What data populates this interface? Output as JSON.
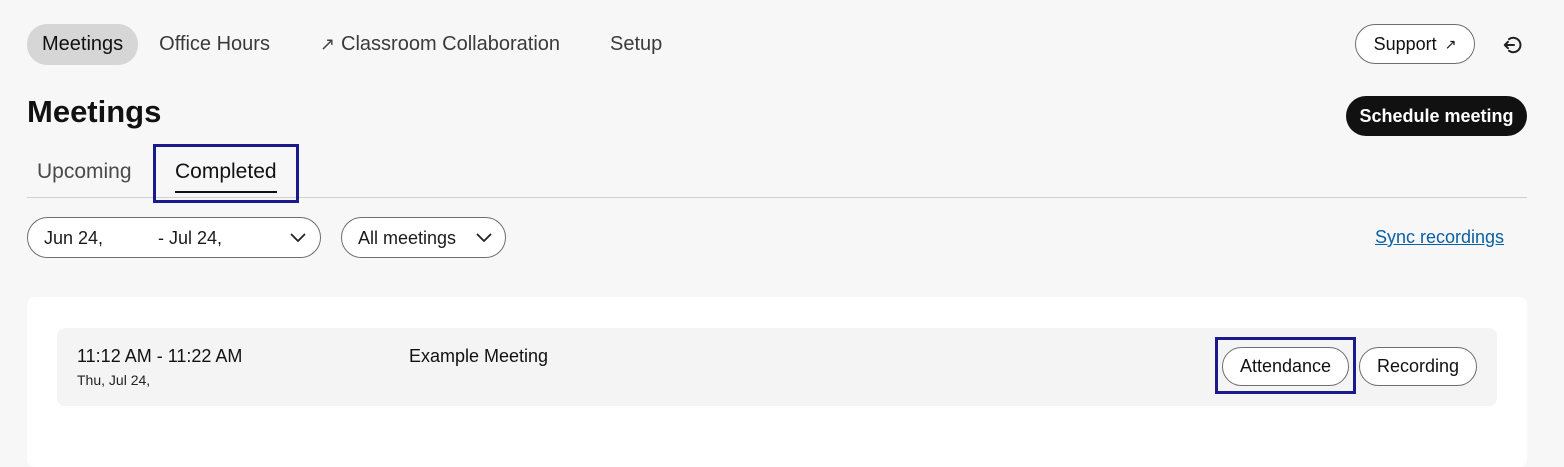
{
  "nav": {
    "items": [
      {
        "label": "Meetings",
        "active": true
      },
      {
        "label": "Office Hours"
      },
      {
        "label": "Classroom Collaboration",
        "external": true
      },
      {
        "label": "Setup"
      }
    ],
    "external_icon": "↗"
  },
  "header": {
    "support_label": "Support",
    "support_icon": "↗",
    "signout_icon": "sign-out-icon"
  },
  "page": {
    "title": "Meetings",
    "schedule_label": "Schedule meeting"
  },
  "tabs": {
    "upcoming": "Upcoming",
    "completed": "Completed",
    "active": "completed"
  },
  "filters": {
    "date_from": "Jun 24,",
    "date_to": "- Jul 24,",
    "meetings_filter": "All meetings",
    "sync_label": "Sync recordings"
  },
  "meetings": [
    {
      "time": "11:12 AM - 11:22 AM",
      "date": "Thu, Jul 24,",
      "title": "Example Meeting",
      "attendance_label": "Attendance",
      "recording_label": "Recording"
    }
  ],
  "colors": {
    "highlight": "#1a1a8c",
    "primary_button": "#111111",
    "link": "#0b5fa5",
    "active_nav_bg": "#d6d6d6"
  }
}
